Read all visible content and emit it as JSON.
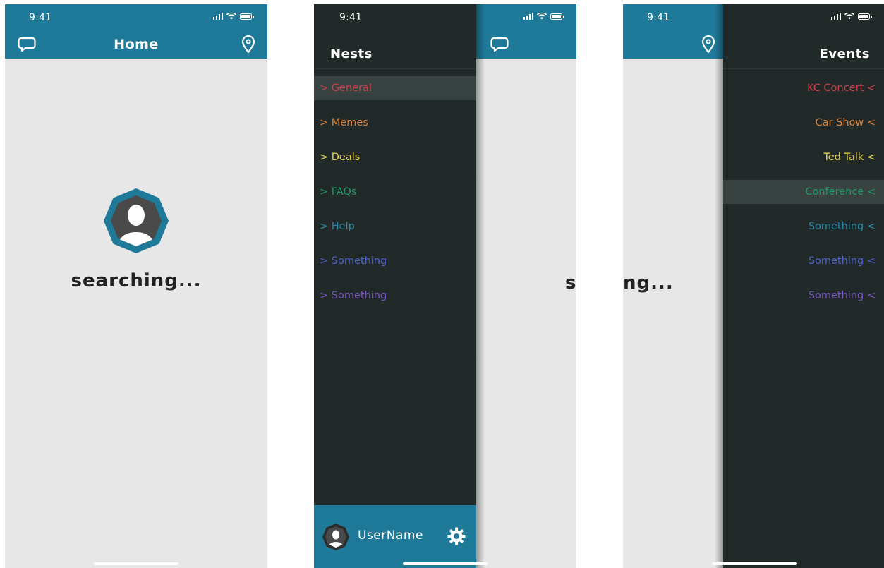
{
  "status": {
    "time": "9:41"
  },
  "home": {
    "title": "Home",
    "search_text": "searching..."
  },
  "nests_drawer": {
    "title": "Nests",
    "items": [
      {
        "label": "> General",
        "color": "#c8434b",
        "active": true
      },
      {
        "label": "> Memes",
        "color": "#d8823a",
        "active": false
      },
      {
        "label": "> Deals",
        "color": "#e3d34a",
        "active": false
      },
      {
        "label": "> FAQs",
        "color": "#1c9a66",
        "active": false
      },
      {
        "label": "> Help",
        "color": "#2a87a8",
        "active": false
      },
      {
        "label": "> Something",
        "color": "#4f62c9",
        "active": false
      },
      {
        "label": "> Something",
        "color": "#7a55c2",
        "active": false
      }
    ],
    "user_name": "UserName"
  },
  "events_drawer": {
    "title": "Events",
    "items": [
      {
        "label": "KC Concert <",
        "color": "#c8434b",
        "active": false
      },
      {
        "label": "Car Show <",
        "color": "#d8823a",
        "active": false
      },
      {
        "label": "Ted Talk <",
        "color": "#e3d34a",
        "active": false
      },
      {
        "label": "Conference <",
        "color": "#1c9a66",
        "active": true
      },
      {
        "label": "Something <",
        "color": "#2a87a8",
        "active": false
      },
      {
        "label": "Something <",
        "color": "#4f62c9",
        "active": false
      },
      {
        "label": "Something <",
        "color": "#7a55c2",
        "active": false
      }
    ]
  },
  "partial_text": {
    "left_fragment": "s",
    "right_fragment": "ng..."
  },
  "colors": {
    "accent": "#1f7a99",
    "drawer_bg": "#222a29",
    "content_bg": "#e7e7e7"
  },
  "icons": {
    "chat": "chat-bubble-icon",
    "location": "location-pin-icon",
    "settings": "gear-icon",
    "avatar": "user-avatar-icon"
  }
}
